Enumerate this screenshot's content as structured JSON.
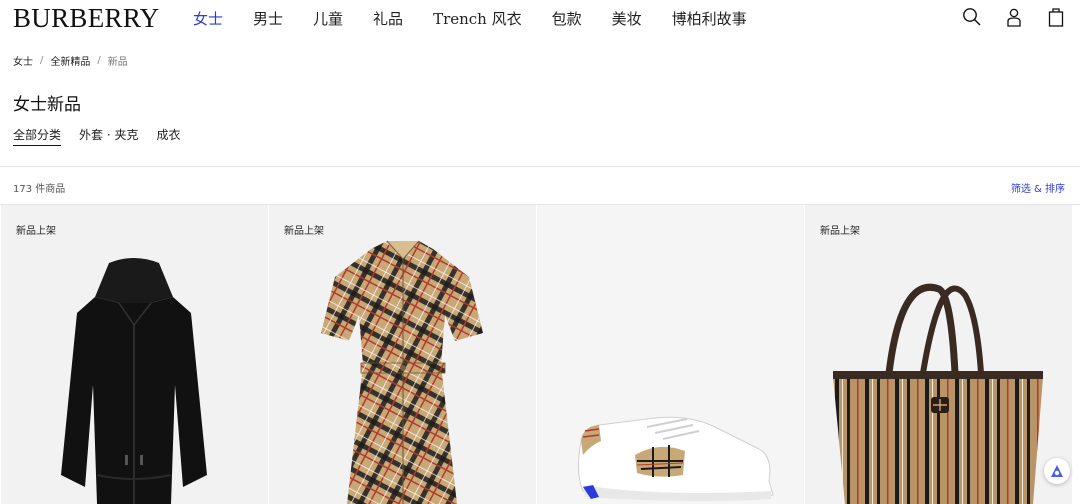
{
  "header": {
    "logo": "BURBERRY",
    "nav": [
      {
        "label": "女士",
        "active": true
      },
      {
        "label": "男士"
      },
      {
        "label": "儿童"
      },
      {
        "label": "礼品"
      },
      {
        "label": "Trench 风衣"
      },
      {
        "label": "包款"
      },
      {
        "label": "美妆"
      },
      {
        "label": "博柏利故事"
      }
    ],
    "icons": [
      "search-icon",
      "account-icon",
      "shopping-bag-icon"
    ]
  },
  "breadcrumb": [
    "女士",
    "全新精品",
    "新品"
  ],
  "page": {
    "title": "女士新品",
    "subcategories": [
      {
        "label": "全部分类",
        "active": true
      },
      {
        "label": "外套 · 夹克"
      },
      {
        "label": "成衣"
      }
    ]
  },
  "results": {
    "count": "173 件商品",
    "filter_label": "筛选 & 排序"
  },
  "products": [
    {
      "badge": "新品上架",
      "image": "black-hooded-jacket"
    },
    {
      "badge": "新品上架",
      "image": "check-shirt-dress"
    },
    {
      "badge": "",
      "image": "white-check-sneaker"
    },
    {
      "badge": "新品上架",
      "image": "check-tote-bag"
    }
  ],
  "colors": {
    "accent": "#2a3bd9",
    "check_beige": "#c9a877"
  }
}
